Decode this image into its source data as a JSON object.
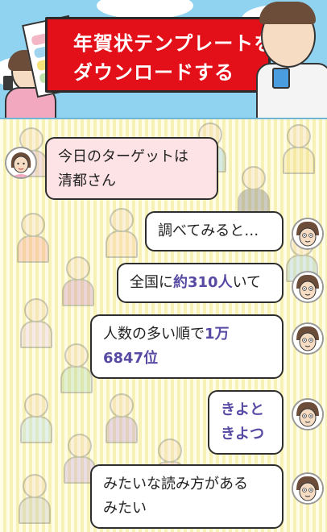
{
  "banner": {
    "line1": "年賀状テンプレートを",
    "line2": "ダウンロードする",
    "colors": {
      "sky": "#8fd3f1",
      "card": "#e3101a"
    }
  },
  "chat": {
    "messages": [
      {
        "side": "left",
        "text": [
          "今日のターゲットは",
          "清都さん"
        ]
      },
      {
        "side": "right",
        "text": [
          "調べてみると…"
        ]
      },
      {
        "side": "right",
        "pre": "全国に",
        "hl": "約310人",
        "post": "いて"
      },
      {
        "side": "right",
        "pre": "人数の多い順で",
        "hl": "1万",
        "line2": "6847位"
      },
      {
        "side": "right",
        "lines": [
          "きよと",
          "きよつ"
        ]
      },
      {
        "side": "right",
        "text": [
          "みたいな読み方がある",
          "みたい"
        ]
      }
    ],
    "colors": {
      "highlight": "#574aa3",
      "pink_bubble": "#fde2e6"
    }
  },
  "icons": [
    "woman-avatar-icon",
    "man-avatar-icon"
  ]
}
